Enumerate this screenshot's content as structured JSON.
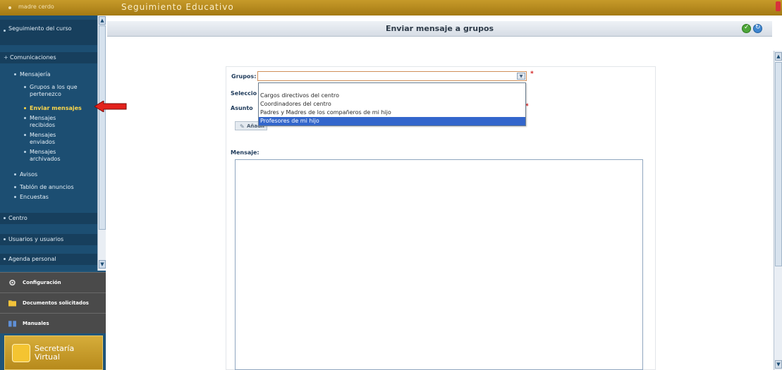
{
  "topbar": {
    "user": "madre cerdo",
    "app_title": "Seguimiento Educativo"
  },
  "sidebar": {
    "items": [
      {
        "label": "Seguimiento del curso"
      },
      {
        "label": "Comunicaciones"
      },
      {
        "label": "Mensajería"
      },
      {
        "label": "Grupos a los que pertenezco"
      },
      {
        "label": "Enviar mensajes"
      },
      {
        "label": "Mensajes recibidos"
      },
      {
        "label": "Mensajes enviados"
      },
      {
        "label": "Mensajes archivados"
      },
      {
        "label": "Avisos"
      },
      {
        "label": "Tablón de anuncios"
      },
      {
        "label": "Encuestas"
      },
      {
        "label": "Centro"
      },
      {
        "label": "Usuarios y usuarios"
      },
      {
        "label": "Agenda personal"
      }
    ],
    "bottom": [
      {
        "label": "Configuración",
        "icon": "gear-icon"
      },
      {
        "label": "Documentos solicitados",
        "icon": "folder-icon"
      },
      {
        "label": "Manuales",
        "icon": "book-icon"
      }
    ],
    "secretaria": "Secretaría Virtual"
  },
  "main": {
    "title": "Enviar mensaje a grupos",
    "form": {
      "grupos_label": "Grupos:",
      "seleccion_label": "Seleccio",
      "asunto_label": "Asunto",
      "required_mark": "*",
      "add_button": "Añadir",
      "mensaje_label": "Mensaje:"
    },
    "dropdown_options": [
      "Cargos directivos del centro",
      "Coordinadores del centro",
      "Padres y Madres de los compañeros de mi hijo",
      "Profesores de mi hijo"
    ],
    "selected_option": "Profesores de mi hijo"
  },
  "colors": {
    "topbar": "#b58a1e",
    "sidebar": "#1c4e72",
    "active_link": "#ffd84a",
    "selected_option": "#3366cc"
  }
}
